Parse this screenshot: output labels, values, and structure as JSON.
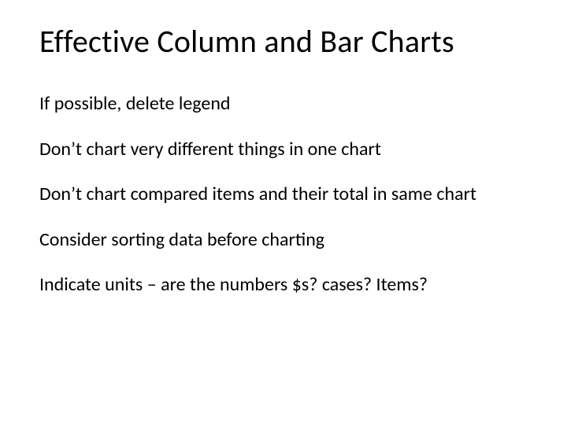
{
  "slide": {
    "title": "Effective Column and Bar Charts",
    "bullets": [
      "If possible, delete legend",
      "Don’t chart very different things in one chart",
      "Don’t chart compared items and their total in same chart",
      "Consider sorting data before charting",
      "Indicate units – are the numbers $s? cases? Items?"
    ]
  }
}
